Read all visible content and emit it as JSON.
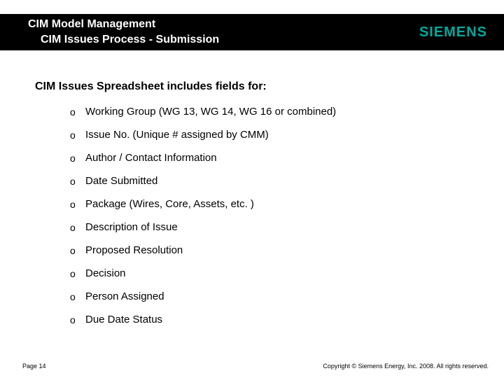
{
  "header": {
    "title_line1": "CIM Model Management",
    "title_line2": "CIM Issues Process - Submission",
    "logo_text": "SIEMENS"
  },
  "intro": "CIM Issues Spreadsheet includes fields for:",
  "fields": [
    "Working Group (WG 13, WG 14, WG 16 or combined)",
    "Issue No. (Unique # assigned by CMM)",
    "Author / Contact Information",
    "Date Submitted",
    "Package (Wires, Core, Assets, etc. )",
    "Description of Issue",
    "Proposed Resolution",
    "Decision",
    "Person Assigned",
    "Due Date Status"
  ],
  "footer": {
    "page": "Page 14",
    "copyright": "Copyright © Siemens Energy, Inc. 2008. All rights reserved."
  }
}
